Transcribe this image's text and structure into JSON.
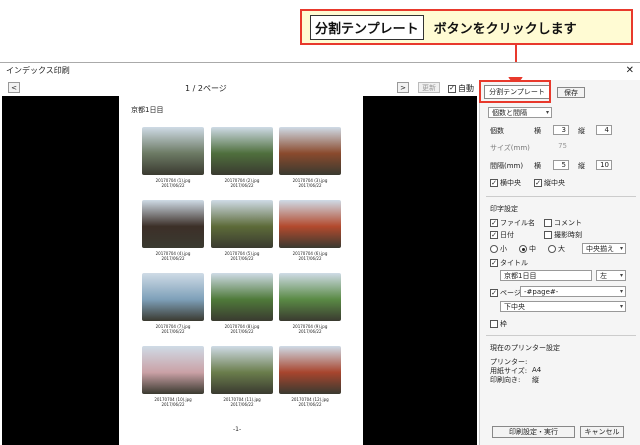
{
  "callout": {
    "boxed": "分割テンプレート",
    "text": "ボタンをクリックします"
  },
  "window": {
    "title": "インデックス印刷",
    "close": "✕"
  },
  "toolbar": {
    "prev": "<",
    "next": ">",
    "page": "1 / 2ページ",
    "update": "更新",
    "auto": "自動"
  },
  "preview": {
    "sheet_title": "京都1日目",
    "page_num": "-1-",
    "photos": [
      {
        "file": "20170704 (1).jpg",
        "date": "2017/06/22",
        "color": "#6c7a64"
      },
      {
        "file": "20170704 (2).jpg",
        "date": "2017/06/22",
        "color": "#4f6f3d"
      },
      {
        "file": "20170704 (3).jpg",
        "date": "2017/06/22",
        "color": "#8a4a2d"
      },
      {
        "file": "20170704 (4).jpg",
        "date": "2017/06/22",
        "color": "#3c2f28"
      },
      {
        "file": "20170704 (5).jpg",
        "date": "2017/06/22",
        "color": "#5d6b39"
      },
      {
        "file": "20170704 (6).jpg",
        "date": "2017/06/22",
        "color": "#b34a2e"
      },
      {
        "file": "20170704 (7).jpg",
        "date": "2017/06/22",
        "color": "#7ea0b9"
      },
      {
        "file": "20170704 (8).jpg",
        "date": "2017/06/22",
        "color": "#4f7a3a"
      },
      {
        "file": "20170704 (9).jpg",
        "date": "2017/06/22",
        "color": "#5a8a45"
      },
      {
        "file": "20170704 (10).jpg",
        "date": "2017/06/22",
        "color": "#caa1a6"
      },
      {
        "file": "20170704 (11).jpg",
        "date": "2017/06/22",
        "color": "#6a7d4c"
      },
      {
        "file": "20170704 (12).jpg",
        "date": "2017/06/22",
        "color": "#a8452e"
      }
    ]
  },
  "panel": {
    "template_btn": "分割テンプレート",
    "save_btn": "保存",
    "mode_select": "個数と間隔",
    "count_label": "個数",
    "count_h_label": "横",
    "count_h": "3",
    "count_v_label": "縦",
    "count_v": "4",
    "size_label": "サイズ(mm)",
    "size_val": "75",
    "gap_label": "間隔(mm)",
    "gap_h_label": "横",
    "gap_h": "5",
    "gap_v_label": "縦",
    "gap_v": "10",
    "center_h": "横中央",
    "center_v": "縦中央",
    "print_settings": "印字設定",
    "filename": "ファイル名",
    "comment": "コメント",
    "date": "日付",
    "shoot_time": "撮影時刻",
    "size_small": "小",
    "size_mid": "中",
    "size_large": "大",
    "align_select": "中央揃え",
    "title_label": "タイトル",
    "title_value": "京都1日目",
    "title_align": "左",
    "page_label": "ページ",
    "page_format": "-#page#-",
    "page_pos": "下中央",
    "frame": "枠",
    "printer_section": "現在のプリンター設定",
    "printer": "プリンター:",
    "paper_label": "用紙サイズ:",
    "paper_value": "A4",
    "orient_label": "印刷向き:",
    "orient_value": "縦",
    "print_btn": "印刷設定・実行",
    "cancel_btn": "キャンセル"
  }
}
